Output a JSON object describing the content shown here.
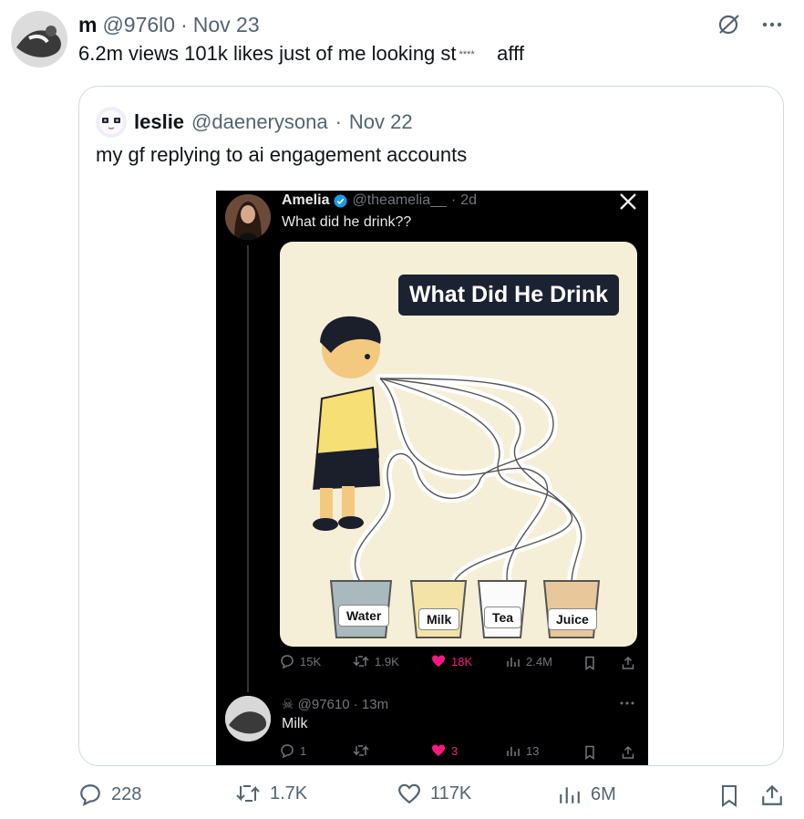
{
  "tweet": {
    "display_name": "m",
    "handle": "@976l0",
    "date": "Nov 23",
    "text": "6.2m views 101k likes just of me looking st",
    "text_after": "afff",
    "icons": [
      "avatar",
      "grok-icon",
      "more-icon"
    ]
  },
  "quote": {
    "display_name": "leslie",
    "handle": "@daenerysona",
    "date": "Nov 22",
    "text": "my gf replying to ai engagement accounts"
  },
  "screenshot": {
    "post": {
      "display_name": "Amelia",
      "handle": "@theamelia__",
      "age": "2d",
      "text": "What did he drink??",
      "panel_title": "What Did He Drink",
      "cups": [
        "Water",
        "Milk",
        "Tea",
        "Juice"
      ],
      "stats": {
        "replies": "15K",
        "reposts": "1.9K",
        "likes": "18K",
        "views": "2.4M"
      }
    },
    "reply": {
      "handle": "@97610",
      "age": "13m",
      "text": "Milk",
      "stats": {
        "replies": "1",
        "likes": "3",
        "views": "13"
      }
    }
  },
  "actions": {
    "replies": "228",
    "reposts": "1.7K",
    "likes": "117K",
    "views": "6M"
  },
  "colors": {
    "like_pink": "#f91880",
    "muted": "#536471",
    "border": "#cfd9de"
  }
}
